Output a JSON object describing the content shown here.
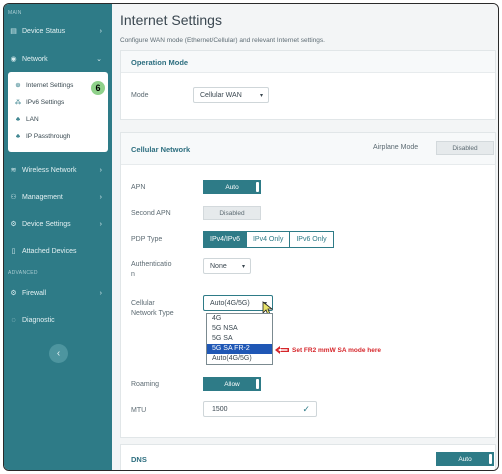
{
  "sidebar": {
    "top_label": "MAIN",
    "items": {
      "device_status": "Device Status",
      "network": "Network",
      "wireless_network": "Wireless Network",
      "management": "Management",
      "device_settings": "Device Settings",
      "attached_devices": "Attached Devices",
      "firewall": "Firewall",
      "diagnostic": "Diagnostic"
    },
    "advanced_label": "ADVANCED",
    "network_sub": {
      "internet_settings": "Internet Settings",
      "ipv6_settings": "IPv6 Settings",
      "lan": "LAN",
      "ip_passthrough": "IP Passthrough"
    },
    "badge": "6"
  },
  "main": {
    "title": "Internet Settings",
    "description": "Configure WAN mode (Ethernet/Cellular) and relevant Internet settings."
  },
  "operation_mode": {
    "title": "Operation Mode",
    "mode_label": "Mode",
    "mode_value": "Cellular WAN"
  },
  "cellular": {
    "title": "Cellular Network",
    "airplane_label": "Airplane Mode",
    "airplane_value": "Disabled",
    "apn_label": "APN",
    "apn_value": "Auto",
    "second_apn_label": "Second APN",
    "second_apn_value": "Disabled",
    "pdp_label": "PDP Type",
    "pdp_options": [
      "IPv4/IPv6",
      "IPv4 Only",
      "IPv6 Only"
    ],
    "auth_label_line1": "Authenticatio",
    "auth_label_line2": "n",
    "auth_value": "None",
    "network_type_label_line1": "Cellular",
    "network_type_label_line2": "Network Type",
    "network_type_value": "Auto(4G/5G)",
    "network_type_options": [
      "4G",
      "5G NSA",
      "5G SA",
      "5G SA FR-2",
      "Auto(4G/5G)"
    ],
    "annotation": "Set FR2 mmW SA mode here",
    "roaming_label": "Roaming",
    "roaming_value": "Allow",
    "mtu_label": "MTU",
    "mtu_value": "1500"
  },
  "dns": {
    "title": "DNS",
    "value": "Auto"
  },
  "colors": {
    "sidebar": "#2e7b87",
    "accent": "#2e7b87",
    "highlight": "#1f57b5",
    "annotation": "#d6262b",
    "badge": "#8fd18a"
  }
}
